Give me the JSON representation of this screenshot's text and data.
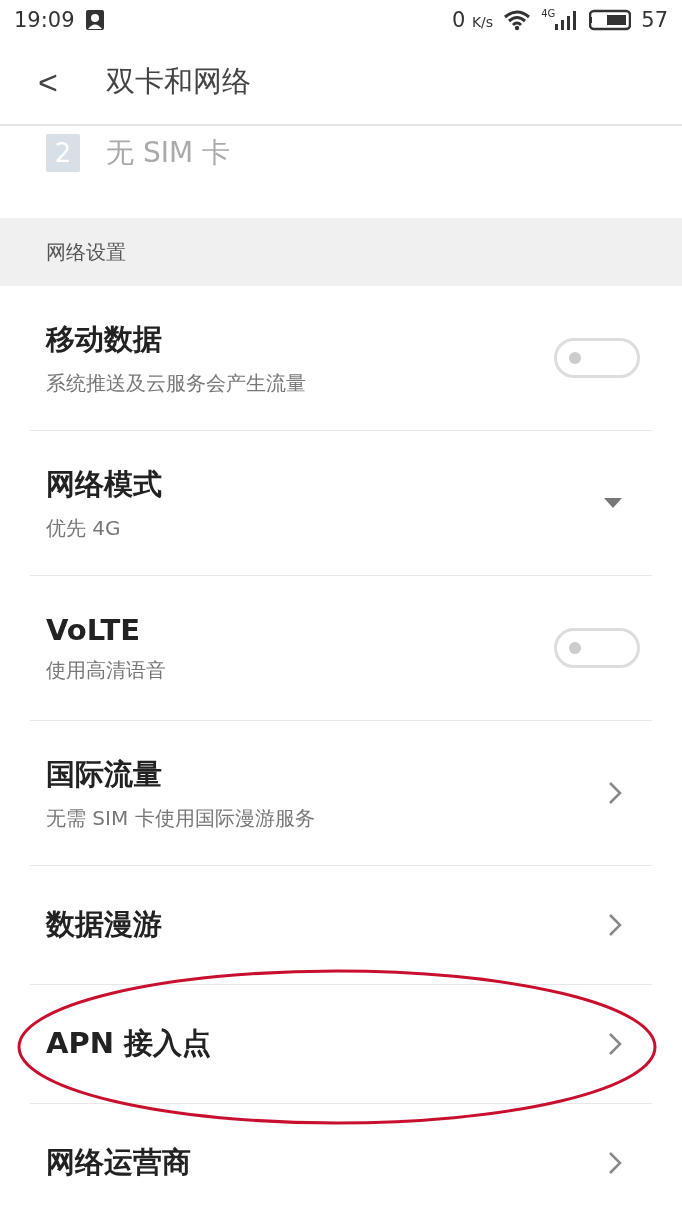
{
  "status_bar": {
    "time": "19:09",
    "speed": "0",
    "speed_unit": "K/s",
    "network": "4G",
    "battery": "57"
  },
  "header": {
    "back": "<",
    "title": "双卡和网络"
  },
  "sim": {
    "slot": "2",
    "label": "无 SIM 卡"
  },
  "section": {
    "title": "网络设置"
  },
  "items": [
    {
      "kind": "toggle",
      "title": "移动数据",
      "subtitle": "系统推送及云服务会产生流量",
      "on": false,
      "annotated": false
    },
    {
      "kind": "dropdown",
      "title": "网络模式",
      "subtitle": "优先 4G",
      "annotated": false
    },
    {
      "kind": "toggle",
      "title": "VoLTE",
      "subtitle": "使用高清语音",
      "on": false,
      "annotated": false
    },
    {
      "kind": "link",
      "title": "国际流量",
      "subtitle": "无需 SIM 卡使用国际漫游服务",
      "annotated": false
    },
    {
      "kind": "link",
      "title": "数据漫游",
      "annotated": false
    },
    {
      "kind": "link",
      "title": "APN 接入点",
      "annotated": true
    },
    {
      "kind": "link",
      "title": "网络运营商",
      "annotated": false
    }
  ]
}
